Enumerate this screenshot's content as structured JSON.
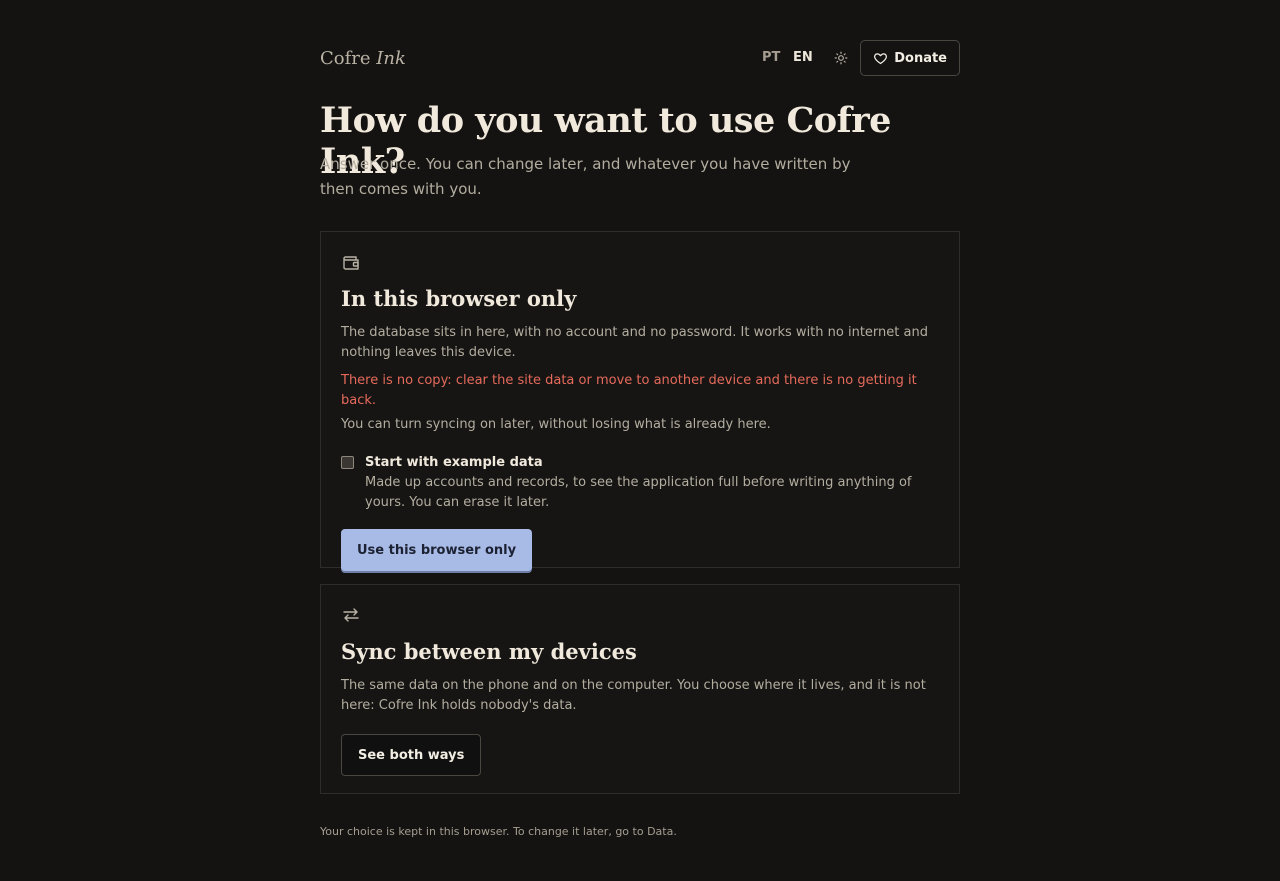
{
  "brand": {
    "name": "Cofre",
    "name_italic": "Ink"
  },
  "header": {
    "languages": [
      "PT",
      "EN"
    ],
    "active_language": "EN",
    "theme_icon": "sun-icon",
    "donate_label": "Donate",
    "donate_icon": "heart-icon"
  },
  "page": {
    "title": "How do you want to use Cofre Ink?",
    "subtitle": "Answer once. You can change later, and whatever you have written by then comes with you."
  },
  "option_browser": {
    "icon": "wallet-icon",
    "title": "In this browser only",
    "description": "The database sits in here, with no account and no password. It works with no internet and nothing leaves this device.",
    "warning": "There is no copy: clear the site data or move to another device and there is no getting it back.",
    "note": "You can turn syncing on later, without losing what is already here.",
    "example_checkbox": {
      "label": "Start with example data",
      "description": "Made up accounts and records, to see the application full before writing anything of yours. You can erase it later.",
      "checked": false
    },
    "button_label": "Use this browser only"
  },
  "option_sync": {
    "icon": "arrows-swap-icon",
    "title": "Sync between my devices",
    "description": "The same data on the phone and on the computer. You choose where it lives, and it is not here: Cofre Ink holds nobody's data.",
    "button_label": "See both ways"
  },
  "footer": {
    "text": "Your choice is kept in this browser. To change it later, go to Data."
  },
  "colors": {
    "background": "#141312",
    "accent_button": "#a7bbe6",
    "warning": "#e56a5a"
  }
}
